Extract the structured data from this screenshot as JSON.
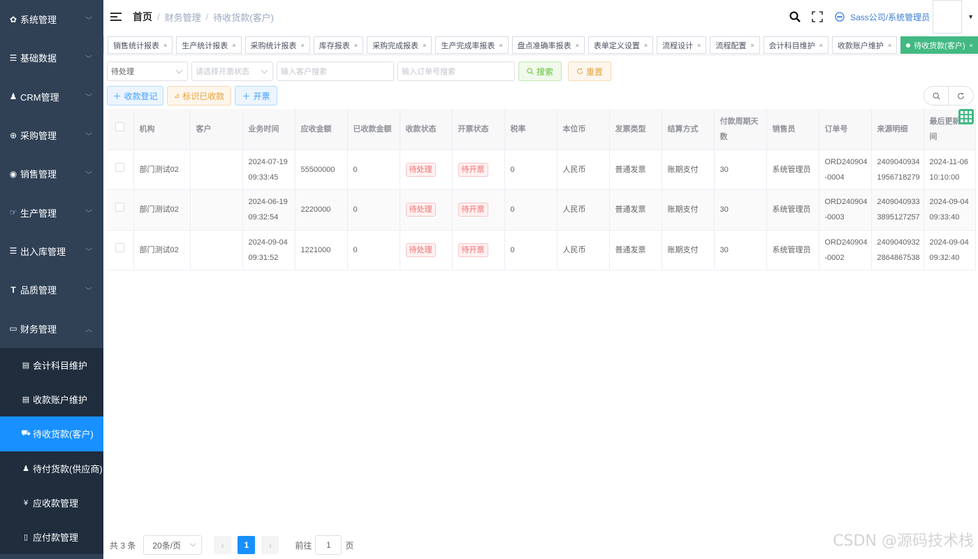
{
  "sidebar": {
    "menus": [
      {
        "label": "系统管理",
        "icon": "gear-icon"
      },
      {
        "label": "基础数据",
        "icon": "list-icon"
      },
      {
        "label": "CRM管理",
        "icon": "users-icon"
      },
      {
        "label": "采购管理",
        "icon": "globe-icon"
      },
      {
        "label": "销售管理",
        "icon": "earth-icon"
      },
      {
        "label": "生产管理",
        "icon": "hand-icon"
      },
      {
        "label": "出入库管理",
        "icon": "list-icon"
      },
      {
        "label": "品质管理",
        "icon": "text-size-icon"
      },
      {
        "label": "财务管理",
        "icon": "monitor-icon"
      }
    ],
    "sub_items": [
      {
        "label": "会计科目维护",
        "icon": "document-icon"
      },
      {
        "label": "收款账户维护",
        "icon": "document-icon"
      },
      {
        "label": "待收货款(客户)",
        "icon": "bus-icon"
      },
      {
        "label": "待付货款(供应商)",
        "icon": "user-icon"
      },
      {
        "label": "应收款管理",
        "icon": "money-icon"
      },
      {
        "label": "应付款管理",
        "icon": "phone-icon"
      }
    ]
  },
  "header": {
    "breadcrumb": [
      "首页",
      "财务管理",
      "待收货款(客户)"
    ],
    "user": "Sass公司/系统管理员"
  },
  "tags": [
    "销售统计报表",
    "生产统计报表",
    "采购统计报表",
    "库存报表",
    "采购完成报表",
    "生产完成率报表",
    "盘点准确率报表",
    "表单定义设置",
    "流程设计",
    "流程配置",
    "会计科目维护",
    "收款账户维护",
    "待收货款(客户)"
  ],
  "search": {
    "status_value": "待处理",
    "invoice_placeholder": "请选择开票状态",
    "customer_placeholder": "输入客户搜索",
    "order_placeholder": "输入订单号搜索",
    "search_label": "搜索",
    "reset_label": "重置"
  },
  "actions": {
    "add_label": "收款登记",
    "mark_label": "标识已收款",
    "invoice_label": "开票"
  },
  "table": {
    "columns": [
      "机构",
      "客户",
      "业务时间",
      "应收金额",
      "已收款金额",
      "收款状态",
      "开票状态",
      "税率",
      "本位币",
      "发票类型",
      "结算方式",
      "付款周期天数",
      "销售员",
      "订单号",
      "来源明细",
      "最后更新时间"
    ],
    "rows": [
      {
        "org": "部门测试02",
        "customer": "",
        "time1": "2024-07-19",
        "time2": "09:33:45",
        "amount": "55500000",
        "received": "0",
        "pay_status": "待处理",
        "inv_status": "待开票",
        "tax": "0",
        "currency": "人民币",
        "inv_type": "普通发票",
        "settle": "账期支付",
        "cycle": "30",
        "seller": "系统管理员",
        "order1": "ORD240904",
        "order2": "-0004",
        "src1": "2409040934",
        "src2": "1956718279",
        "upd1": "2024-11-06",
        "upd2": "10:10:00"
      },
      {
        "org": "部门测试02",
        "customer": "",
        "time1": "2024-06-19",
        "time2": "09:32:54",
        "amount": "2220000",
        "received": "0",
        "pay_status": "待处理",
        "inv_status": "待开票",
        "tax": "0",
        "currency": "人民币",
        "inv_type": "普通发票",
        "settle": "账期支付",
        "cycle": "30",
        "seller": "系统管理员",
        "order1": "ORD240904",
        "order2": "-0003",
        "src1": "2409040933",
        "src2": "3895127257",
        "upd1": "2024-09-04",
        "upd2": "09:33:40"
      },
      {
        "org": "部门测试02",
        "customer": "",
        "time1": "2024-09-04",
        "time2": "09:31:52",
        "amount": "1221000",
        "received": "0",
        "pay_status": "待处理",
        "inv_status": "待开票",
        "tax": "0",
        "currency": "人民币",
        "inv_type": "普通发票",
        "settle": "账期支付",
        "cycle": "30",
        "seller": "系统管理员",
        "order1": "ORD240904",
        "order2": "-0002",
        "src1": "2409040932",
        "src2": "2864867538",
        "upd1": "2024-09-04",
        "upd2": "09:32:40"
      }
    ]
  },
  "pagination": {
    "total": "共 3 条",
    "page_size": "20条/页",
    "current": "1",
    "goto_prefix": "前往",
    "goto_value": "1",
    "goto_suffix": "页"
  },
  "watermark": "CSDN @源码技术栈",
  "colors": {
    "sidebar": "#304156",
    "active": "#1890ff",
    "tag_active": "#42b983"
  }
}
